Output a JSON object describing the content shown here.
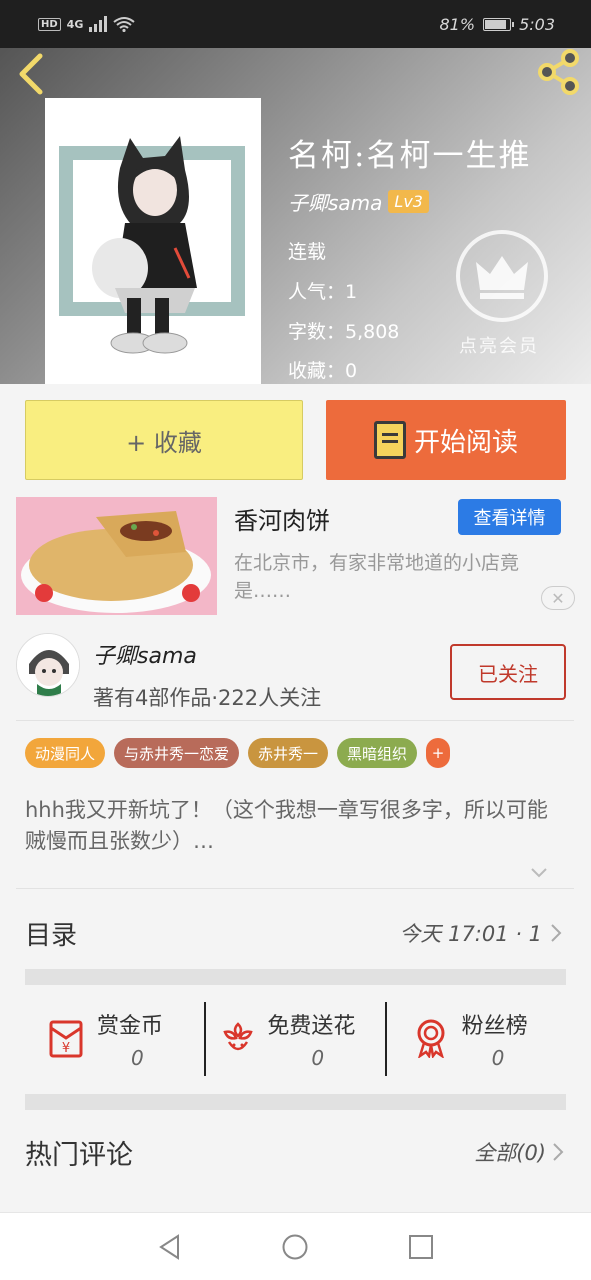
{
  "status_bar": {
    "hd": "HD",
    "network": "4G",
    "battery_percent": "81%",
    "time": "5:03"
  },
  "header": {
    "back_icon": "back-arrow-icon",
    "share_icon": "share-icon"
  },
  "book": {
    "title": "名柯:名柯一生推",
    "author": "子卿sama",
    "level": "Lv3",
    "status": "连载",
    "popularity": "人气：1",
    "word_count": "字数：5,808",
    "favorites": "收藏：0",
    "vip_label": "点亮会员"
  },
  "buttons": {
    "collect": "+ 收藏",
    "start_reading": "开始阅读"
  },
  "ad": {
    "title": "香河肉饼",
    "detail_button": "查看详情",
    "description": "在北京市，有家非常地道的小店竟是……",
    "close_icon": "close-icon"
  },
  "author_card": {
    "name": "子卿sama",
    "stats": "著有4部作品·222人关注",
    "follow_button": "已关注"
  },
  "tags": [
    {
      "label": "动漫同人",
      "color": "#f2a63b"
    },
    {
      "label": "与赤井秀一恋爱",
      "color": "#b86b5a"
    },
    {
      "label": "赤井秀一",
      "color": "#c9953f"
    },
    {
      "label": "黑暗组织",
      "color": "#8cab4f"
    },
    {
      "label": "+",
      "color": "#ed6b3c"
    }
  ],
  "description": "hhh我又开新坑了！（这个我想一章写很多字，所以可能贼慢而且张数少）…",
  "toc": {
    "title": "目录",
    "info": "今天 17:01 · 1"
  },
  "actions": [
    {
      "label": "赏金币",
      "count": "0",
      "icon": "red-envelope-icon"
    },
    {
      "label": "免费送花",
      "count": "0",
      "icon": "flower-icon"
    },
    {
      "label": "粉丝榜",
      "count": "0",
      "icon": "medal-icon"
    }
  ],
  "comments": {
    "title": "热门评论",
    "all": "全部(0)"
  },
  "colors": {
    "accent_orange": "#ed6b3c",
    "collect_yellow": "#f9ee80",
    "follow_red": "#c0392b",
    "detail_blue": "#2c7be5",
    "back_yellow": "#f2d96a"
  }
}
